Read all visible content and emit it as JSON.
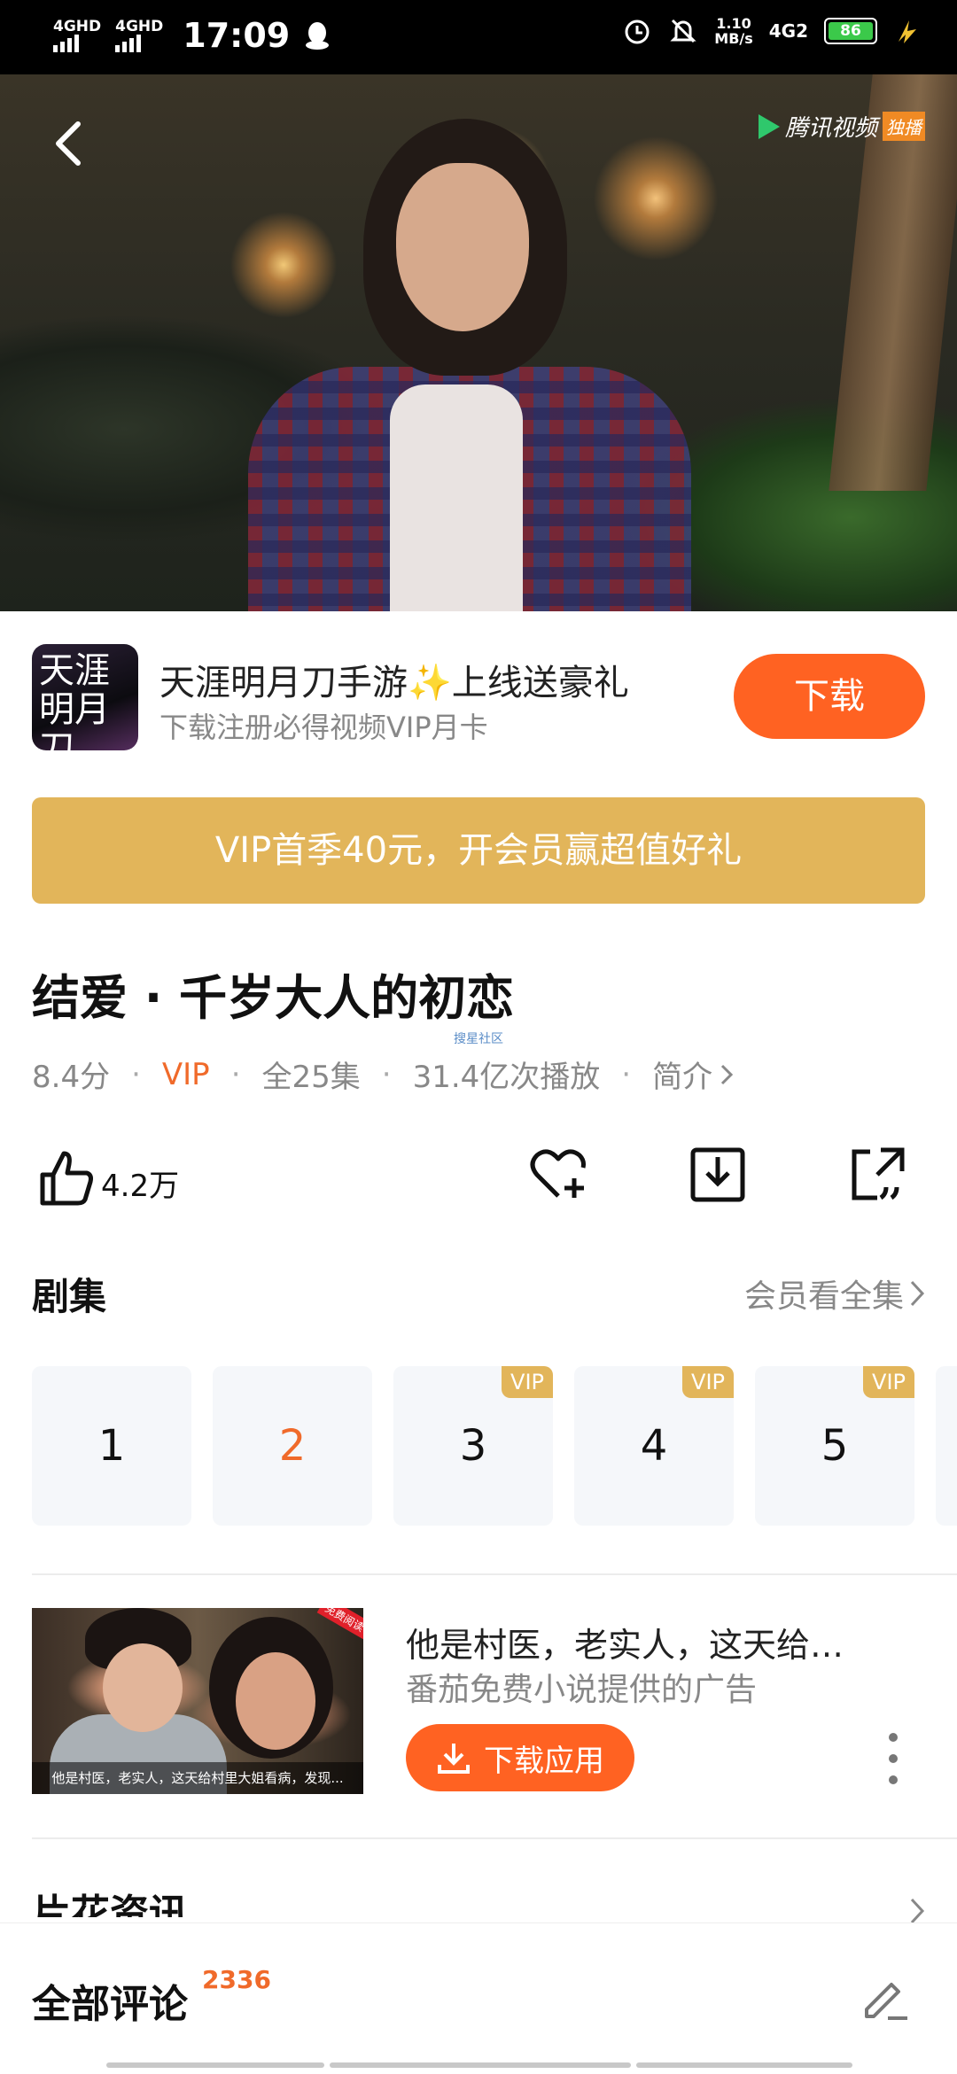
{
  "status_bar": {
    "signal1": "4GHD",
    "signal2": "4GHD",
    "time": "17:09",
    "speed_value": "1.10",
    "speed_unit": "MB/s",
    "network": "4G2",
    "battery": "86"
  },
  "video": {
    "provider_logo": "腾讯视频",
    "provider_tag": "独播"
  },
  "ad_banner": {
    "icon_text": "天涯明月刀",
    "title": "天涯明月刀手游✨上线送豪礼",
    "subtitle": "下载注册必得视频VIP月卡",
    "button": "下载"
  },
  "vip_promo": "VIP首季40元，开会员赢超值好礼",
  "show": {
    "title": "结爱 · 千岁大人的初恋",
    "watermark": "搜星社区",
    "rating": "8.4分",
    "vip": "VIP",
    "episodes_total": "全25集",
    "plays": "31.4亿次播放",
    "intro": "简介"
  },
  "actions": {
    "likes": "4.2万"
  },
  "episodes": {
    "section_title": "剧集",
    "all_link": "会员看全集",
    "items": [
      {
        "num": "1",
        "badge": ""
      },
      {
        "num": "2",
        "badge": ""
      },
      {
        "num": "3",
        "badge": "VIP"
      },
      {
        "num": "4",
        "badge": "VIP"
      },
      {
        "num": "5",
        "badge": "VIP"
      }
    ]
  },
  "ad_card": {
    "image_caption": "他是村医，老实人，这天给村里大姐看病，发现...",
    "image_corner": "免费阅读",
    "title": "他是村医，老实人，这天给…",
    "subtitle": "番茄免费小说提供的广告",
    "button": "下载应用"
  },
  "news": {
    "title": "片花资讯"
  },
  "comments": {
    "title": "全部评论",
    "count": "2336"
  },
  "colors": {
    "accent_orange": "#ff6222",
    "vip_gold": "#e2b55a",
    "battery_green": "#3bc94a"
  }
}
